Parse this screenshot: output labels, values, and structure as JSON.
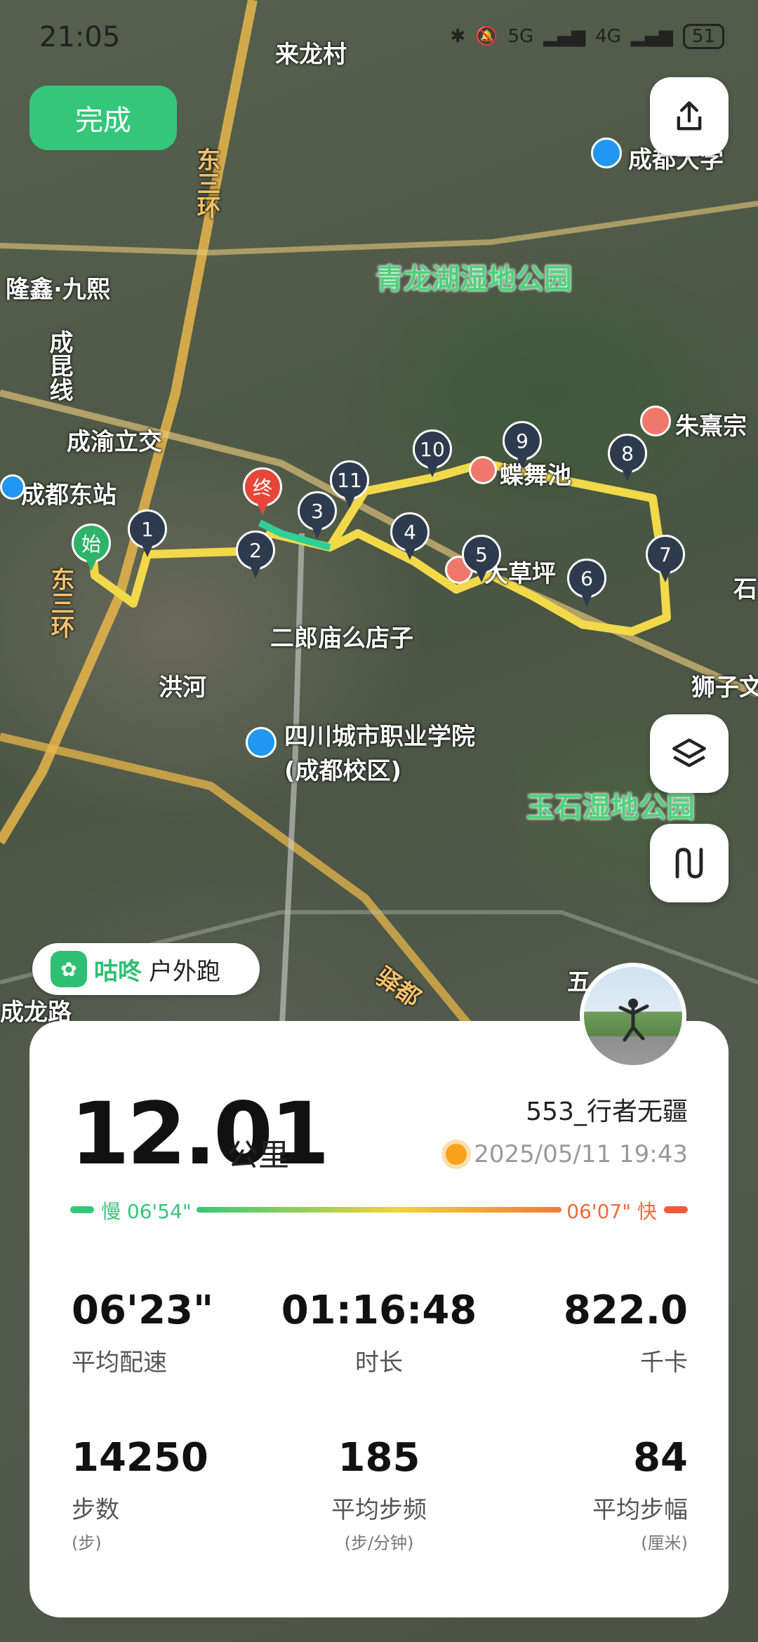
{
  "status_bar": {
    "time": "21:05",
    "signal": "5G",
    "signal2": "4G",
    "battery": "51"
  },
  "done_label": "完成",
  "map": {
    "places": [
      {
        "key": "p1",
        "text": "来龙村",
        "style": ""
      },
      {
        "key": "p2",
        "text": "成都大学",
        "style": ""
      },
      {
        "key": "p3",
        "text": "东三环",
        "style": "orange"
      },
      {
        "key": "p4",
        "text": "隆鑫·九熙",
        "style": ""
      },
      {
        "key": "p5",
        "text": "青龙湖湿地公园",
        "style": "green"
      },
      {
        "key": "p6",
        "text": "成昆线",
        "style": ""
      },
      {
        "key": "p7",
        "text": "成渝立交",
        "style": ""
      },
      {
        "key": "p8",
        "text": "朱熹宗",
        "style": ""
      },
      {
        "key": "p9",
        "text": "成都东站",
        "style": ""
      },
      {
        "key": "p10",
        "text": "蝶舞池",
        "style": ""
      },
      {
        "key": "p11",
        "text": "大草坪",
        "style": ""
      },
      {
        "key": "p12",
        "text": "二郎庙么店子",
        "style": ""
      },
      {
        "key": "p13",
        "text": "洪河",
        "style": ""
      },
      {
        "key": "p14",
        "text": "狮子文",
        "style": ""
      },
      {
        "key": "p15",
        "text": "四川城市职业学院(成都校区)",
        "style": ""
      },
      {
        "key": "p16",
        "text": "玉石湿地公园",
        "style": "green"
      },
      {
        "key": "p17",
        "text": "五",
        "style": ""
      },
      {
        "key": "p18",
        "text": "驿都",
        "style": "orange"
      },
      {
        "key": "p19",
        "text": "成龙路",
        "style": ""
      },
      {
        "key": "p20",
        "text": "东三环",
        "style": "orange"
      },
      {
        "key": "p21",
        "text": "石",
        "style": ""
      }
    ],
    "markers": {
      "start": "始",
      "end": "终",
      "km": [
        "1",
        "2",
        "3",
        "4",
        "5",
        "6",
        "7",
        "8",
        "9",
        "10",
        "11"
      ]
    }
  },
  "app": {
    "name": "咕咚",
    "mode": "户外跑"
  },
  "summary": {
    "distance": "12.01",
    "distance_unit": "公里",
    "username": "553_行者无疆",
    "datetime": "2025/05/11 19:43",
    "slow_label": "慢 06'54\"",
    "fast_label": "06'07\" 快"
  },
  "stats": [
    {
      "value": "06'23\"",
      "label": "平均配速",
      "sub": ""
    },
    {
      "value": "01:16:48",
      "label": "时长",
      "sub": ""
    },
    {
      "value": "822.0",
      "label": "千卡",
      "sub": ""
    },
    {
      "value": "14250",
      "label": "步数",
      "sub": "(步)"
    },
    {
      "value": "185",
      "label": "平均步频",
      "sub": "(步/分钟)"
    },
    {
      "value": "84",
      "label": "平均步幅",
      "sub": "(厘米)"
    }
  ]
}
